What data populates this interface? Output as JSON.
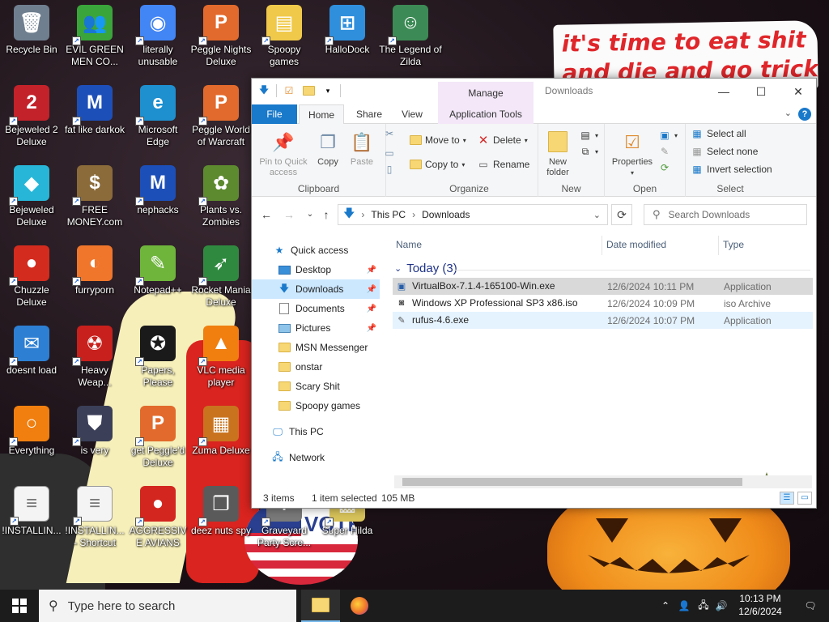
{
  "wallpaper": {
    "caption_line1": "it's time to eat shit",
    "caption_line2": "and die and go trick",
    "sign_text": "VOTE"
  },
  "desktop_icons": [
    {
      "label": "Recycle Bin",
      "icon": "recycle-bin-icon",
      "color": "#6f7f8f",
      "glyph": "🗑"
    },
    {
      "label": "EVIL GREEN MEN CO...",
      "icon": "green-men-icon",
      "color": "#3aa53a",
      "glyph": "👥"
    },
    {
      "label": "literally unusable",
      "icon": "chrome-icon",
      "color": "#4285f4",
      "glyph": "◉"
    },
    {
      "label": "Peggle Nights Deluxe",
      "icon": "peggle-icon",
      "color": "#e26a2c",
      "glyph": "P"
    },
    {
      "label": "Spoopy games",
      "icon": "folder-icon",
      "color": "#f0c94a",
      "glyph": "▤"
    },
    {
      "label": "HalloDock",
      "icon": "windows-logo-icon",
      "color": "#2f8fdc",
      "glyph": "⊞"
    },
    {
      "label": "The Legend of Zilda",
      "icon": "zelda-icon",
      "color": "#3c8a55",
      "glyph": "☺"
    },
    {
      "label": "Bejeweled 2 Deluxe",
      "icon": "bejeweled2-icon",
      "color": "#c3222a",
      "glyph": "2"
    },
    {
      "label": "fat like darkok",
      "icon": "mpi-icon",
      "color": "#1d4fb8",
      "glyph": "M"
    },
    {
      "label": "Microsoft Edge",
      "icon": "edge-icon",
      "color": "#1e8fcf",
      "glyph": "e"
    },
    {
      "label": "Peggle World of Warcraft",
      "icon": "peggle-wow-icon",
      "color": "#e26a2c",
      "glyph": "P"
    },
    {
      "label": "Bejeweled Deluxe",
      "icon": "bejeweled-icon",
      "color": "#27b6d8",
      "glyph": "◆"
    },
    {
      "label": "FREE MONEY.com",
      "icon": "money-bag-icon",
      "color": "#8b6b3a",
      "glyph": "$"
    },
    {
      "label": "nephacks",
      "icon": "mpi-icon-2",
      "color": "#1d4fb8",
      "glyph": "M"
    },
    {
      "label": "Plants vs. Zombies",
      "icon": "pvz-icon",
      "color": "#5d8a2f",
      "glyph": "✿"
    },
    {
      "label": "Chuzzle Deluxe",
      "icon": "chuzzle-icon",
      "color": "#d32b1e",
      "glyph": "●"
    },
    {
      "label": "furryporn",
      "icon": "firefox-icon",
      "color": "#f0762b",
      "glyph": "◐"
    },
    {
      "label": "Notepad++",
      "icon": "notepad-icon",
      "color": "#6fb53c",
      "glyph": "✎"
    },
    {
      "label": "Rocket Mania Deluxe",
      "icon": "rocket-icon",
      "color": "#2f8a3f",
      "glyph": "➶"
    },
    {
      "label": "doesnt load",
      "icon": "thunderbird-icon",
      "color": "#2d7fd3",
      "glyph": "✉"
    },
    {
      "label": "Heavy Weap...",
      "icon": "radiation-icon",
      "color": "#c8201c",
      "glyph": "☢"
    },
    {
      "label": "Papers, Please",
      "icon": "papers-icon",
      "color": "#1a1a1a",
      "glyph": "✪"
    },
    {
      "label": "VLC media player",
      "icon": "vlc-icon",
      "color": "#f07f0f",
      "glyph": "▲"
    },
    {
      "label": "Everything",
      "icon": "search-everything-icon",
      "color": "#f07f0f",
      "glyph": "○"
    },
    {
      "label": "is very",
      "icon": "shield-icon",
      "color": "#3b3f58",
      "glyph": "⛊"
    },
    {
      "label": "get Peggle'd Deluxe",
      "icon": "peggle-icon-2",
      "color": "#e26a2c",
      "glyph": "P"
    },
    {
      "label": "Zuma Deluxe",
      "icon": "zuma-icon",
      "color": "#c9731f",
      "glyph": "▦"
    },
    {
      "label": "!INSTALLIN...",
      "icon": "text-file-icon",
      "color": "#f4f4f4",
      "glyph": "≡"
    },
    {
      "label": "!INSTALLIN... - Shortcut",
      "icon": "text-file-shortcut-icon",
      "color": "#f4f4f4",
      "glyph": "≡"
    },
    {
      "label": "AGGRESSIVE AVIANS",
      "icon": "angry-birds-icon",
      "color": "#d3261f",
      "glyph": "●"
    },
    {
      "label": "deez nuts spy",
      "icon": "copy-windows-icon",
      "color": "#5a5a5a",
      "glyph": "❐"
    },
    {
      "label": "Graveyard Party Scre...",
      "icon": "graveyard-icon",
      "color": "#7a7a7a",
      "glyph": "✝"
    },
    {
      "label": "Super Hilda",
      "icon": "super-hilda-icon",
      "color": "#d8c35a",
      "glyph": "▩"
    }
  ],
  "explorer": {
    "title": "Downloads",
    "context_tab": "Manage",
    "tabs": {
      "file": "File",
      "home": "Home",
      "share": "Share",
      "view": "View",
      "app_tools": "Application Tools"
    },
    "ribbon": {
      "clipboard": {
        "name": "Clipboard",
        "pin": "Pin to Quick access",
        "copy": "Copy",
        "paste": "Paste"
      },
      "organize": {
        "name": "Organize",
        "move_to": "Move to",
        "copy_to": "Copy to",
        "delete": "Delete",
        "rename": "Rename"
      },
      "new": {
        "name": "New",
        "new_folder": "New folder"
      },
      "open": {
        "name": "Open",
        "properties": "Properties"
      },
      "select": {
        "name": "Select",
        "select_all": "Select all",
        "select_none": "Select none",
        "invert": "Invert selection"
      }
    },
    "breadcrumb": [
      "This PC",
      "Downloads"
    ],
    "search_placeholder": "Search Downloads",
    "nav": {
      "quick_access": "Quick access",
      "items": [
        {
          "label": "Desktop",
          "pinned": true
        },
        {
          "label": "Downloads",
          "pinned": true,
          "selected": true
        },
        {
          "label": "Documents",
          "pinned": true
        },
        {
          "label": "Pictures",
          "pinned": true
        },
        {
          "label": "MSN Messenger",
          "pinned": false
        },
        {
          "label": "onstar",
          "pinned": false
        },
        {
          "label": "Scary Shit",
          "pinned": false
        },
        {
          "label": "Spoopy games",
          "pinned": false
        }
      ],
      "this_pc": "This PC",
      "network": "Network"
    },
    "columns": {
      "name": "Name",
      "date": "Date modified",
      "type": "Type"
    },
    "group": "Today (3)",
    "files": [
      {
        "name": "VirtualBox-7.1.4-165100-Win.exe",
        "date": "12/6/2024 10:11 PM",
        "type": "Application",
        "icon": "virtualbox-icon",
        "selected": true
      },
      {
        "name": "Windows XP Professional SP3 x86.iso",
        "date": "12/6/2024 10:09 PM",
        "type": "iso Archive",
        "icon": "iso-file-icon",
        "selected": false
      },
      {
        "name": "rufus-4.6.exe",
        "date": "12/6/2024 10:07 PM",
        "type": "Application",
        "icon": "rufus-icon",
        "selected": false
      }
    ],
    "status": {
      "items": "3 items",
      "selected": "1 item selected",
      "size": "105 MB"
    }
  },
  "taskbar": {
    "search_placeholder": "Type here to search",
    "time": "10:13 PM",
    "date": "12/6/2024"
  }
}
